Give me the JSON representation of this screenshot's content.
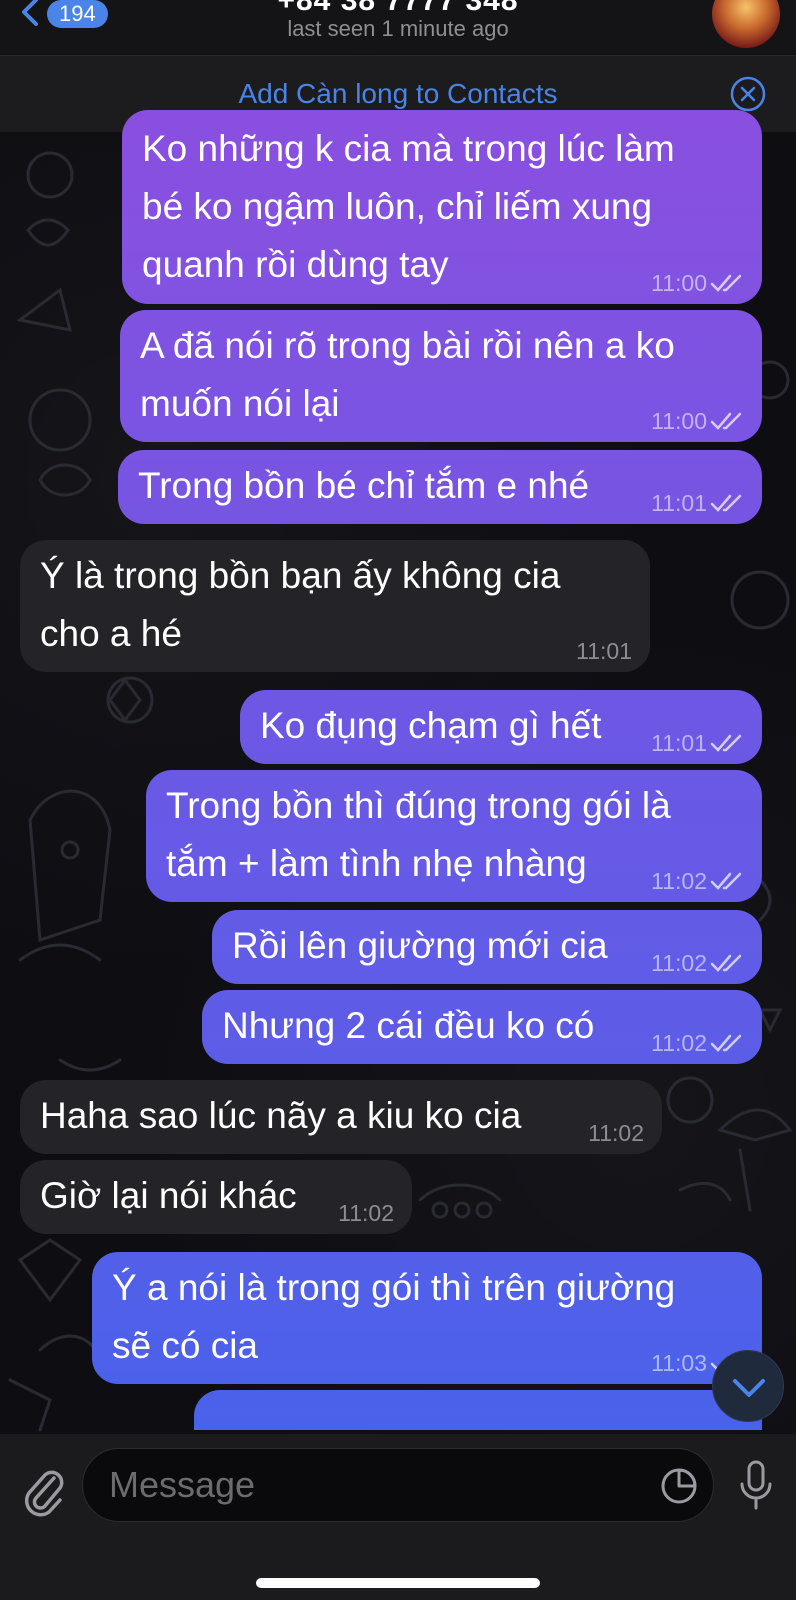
{
  "header": {
    "back_count": "194",
    "contact_number": "+84 38 7777 348",
    "last_seen": "last seen 1 minute ago"
  },
  "contact_bar": {
    "add_contact": "Add Càn long to Contacts"
  },
  "messages": [
    {
      "text": "Ko những k cia mà trong lúc làm\nbé ko ngậm luôn, chỉ liếm xung\nquanh rồi dùng tay",
      "time": "11:00",
      "outgoing": true
    },
    {
      "text": "A đã nói rõ trong bài rồi nên a ko\nmuốn nói lại",
      "time": "11:00",
      "outgoing": true
    },
    {
      "text": "Trong bồn bé chỉ tắm e nhé",
      "time": "11:01",
      "outgoing": true
    },
    {
      "text": "Ý là trong bồn bạn ấy không cia\ncho a hé",
      "time": "11:01",
      "outgoing": false
    },
    {
      "text": "Ko đụng chạm gì hết",
      "time": "11:01",
      "outgoing": true
    },
    {
      "text": "Trong bồn thì đúng trong gói là\ntắm + làm tình nhẹ nhàng",
      "time": "11:02",
      "outgoing": true
    },
    {
      "text": "Rồi lên giường mới cia",
      "time": "11:02",
      "outgoing": true
    },
    {
      "text": "Nhưng 2 cái đều ko có",
      "time": "11:02",
      "outgoing": true
    },
    {
      "text": "Haha sao lúc nãy a kiu ko cia",
      "time": "11:02",
      "outgoing": false
    },
    {
      "text": "Giờ lại nói khác",
      "time": "11:02",
      "outgoing": false
    },
    {
      "text": "Ý a nói là trong gói thì trên giường\nsẽ có cia",
      "time": "11:03",
      "outgoing": true
    }
  ],
  "input": {
    "placeholder": "Message"
  },
  "colors": {
    "accent": "#4a84e8",
    "bubble_out_top": "#8a4fe0",
    "bubble_out_bottom": "#4a62ea",
    "bubble_in": "#232328"
  },
  "icons": [
    "back-chevron-icon",
    "close-circle-icon",
    "double-check-icon",
    "chevron-down-icon",
    "paperclip-icon",
    "sticker-icon",
    "microphone-icon"
  ]
}
